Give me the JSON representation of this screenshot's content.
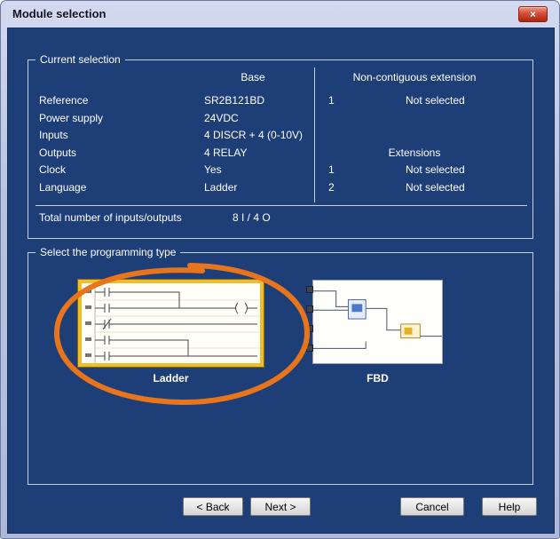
{
  "window": {
    "title": "Module selection",
    "close_glyph": "×"
  },
  "current_selection": {
    "legend": "Current selection",
    "base_header": "Base",
    "left_rows": [
      {
        "label": "Reference",
        "value": "SR2B121BD"
      },
      {
        "label": "Power supply",
        "value": "24VDC"
      },
      {
        "label": "Inputs",
        "value": "4 DISCR + 4 (0-10V)"
      },
      {
        "label": "Outputs",
        "value": "4 RELAY"
      },
      {
        "label": "Clock",
        "value": "Yes"
      },
      {
        "label": "Language",
        "value": "Ladder"
      }
    ],
    "non_contiguous": {
      "header": "Non-contiguous extension",
      "rows": [
        {
          "index": "1",
          "status": "Not selected"
        }
      ]
    },
    "extensions": {
      "header": "Extensions",
      "rows": [
        {
          "index": "1",
          "status": "Not selected"
        },
        {
          "index": "2",
          "status": "Not selected"
        }
      ]
    },
    "total_label": "Total number of inputs/outputs",
    "total_value": "8 I / 4 O"
  },
  "programming_type": {
    "legend": "Select the programming type",
    "options": [
      {
        "label": "Ladder",
        "selected": true
      },
      {
        "label": "FBD",
        "selected": false
      }
    ]
  },
  "buttons": {
    "back": "< Back",
    "next": "Next >",
    "cancel": "Cancel",
    "help": "Help"
  },
  "colors": {
    "client_bg": "#1e3e77",
    "selected_border": "#eebe2e",
    "annotation": "#e8751c"
  }
}
